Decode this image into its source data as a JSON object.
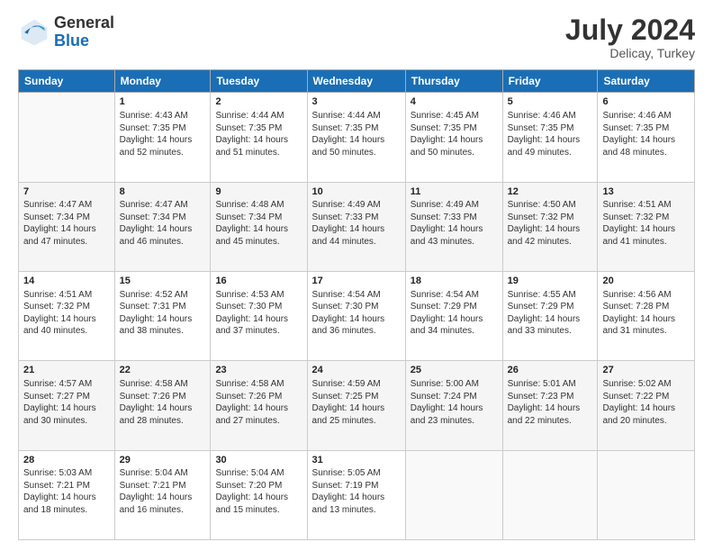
{
  "logo": {
    "general": "General",
    "blue": "Blue"
  },
  "header": {
    "month_year": "July 2024",
    "location": "Delicay, Turkey"
  },
  "weekdays": [
    "Sunday",
    "Monday",
    "Tuesday",
    "Wednesday",
    "Thursday",
    "Friday",
    "Saturday"
  ],
  "weeks": [
    [
      {
        "day": "",
        "sunrise": "",
        "sunset": "",
        "daylight": ""
      },
      {
        "day": "1",
        "sunrise": "Sunrise: 4:43 AM",
        "sunset": "Sunset: 7:35 PM",
        "daylight": "Daylight: 14 hours and 52 minutes."
      },
      {
        "day": "2",
        "sunrise": "Sunrise: 4:44 AM",
        "sunset": "Sunset: 7:35 PM",
        "daylight": "Daylight: 14 hours and 51 minutes."
      },
      {
        "day": "3",
        "sunrise": "Sunrise: 4:44 AM",
        "sunset": "Sunset: 7:35 PM",
        "daylight": "Daylight: 14 hours and 50 minutes."
      },
      {
        "day": "4",
        "sunrise": "Sunrise: 4:45 AM",
        "sunset": "Sunset: 7:35 PM",
        "daylight": "Daylight: 14 hours and 50 minutes."
      },
      {
        "day": "5",
        "sunrise": "Sunrise: 4:46 AM",
        "sunset": "Sunset: 7:35 PM",
        "daylight": "Daylight: 14 hours and 49 minutes."
      },
      {
        "day": "6",
        "sunrise": "Sunrise: 4:46 AM",
        "sunset": "Sunset: 7:35 PM",
        "daylight": "Daylight: 14 hours and 48 minutes."
      }
    ],
    [
      {
        "day": "7",
        "sunrise": "Sunrise: 4:47 AM",
        "sunset": "Sunset: 7:34 PM",
        "daylight": "Daylight: 14 hours and 47 minutes."
      },
      {
        "day": "8",
        "sunrise": "Sunrise: 4:47 AM",
        "sunset": "Sunset: 7:34 PM",
        "daylight": "Daylight: 14 hours and 46 minutes."
      },
      {
        "day": "9",
        "sunrise": "Sunrise: 4:48 AM",
        "sunset": "Sunset: 7:34 PM",
        "daylight": "Daylight: 14 hours and 45 minutes."
      },
      {
        "day": "10",
        "sunrise": "Sunrise: 4:49 AM",
        "sunset": "Sunset: 7:33 PM",
        "daylight": "Daylight: 14 hours and 44 minutes."
      },
      {
        "day": "11",
        "sunrise": "Sunrise: 4:49 AM",
        "sunset": "Sunset: 7:33 PM",
        "daylight": "Daylight: 14 hours and 43 minutes."
      },
      {
        "day": "12",
        "sunrise": "Sunrise: 4:50 AM",
        "sunset": "Sunset: 7:32 PM",
        "daylight": "Daylight: 14 hours and 42 minutes."
      },
      {
        "day": "13",
        "sunrise": "Sunrise: 4:51 AM",
        "sunset": "Sunset: 7:32 PM",
        "daylight": "Daylight: 14 hours and 41 minutes."
      }
    ],
    [
      {
        "day": "14",
        "sunrise": "Sunrise: 4:51 AM",
        "sunset": "Sunset: 7:32 PM",
        "daylight": "Daylight: 14 hours and 40 minutes."
      },
      {
        "day": "15",
        "sunrise": "Sunrise: 4:52 AM",
        "sunset": "Sunset: 7:31 PM",
        "daylight": "Daylight: 14 hours and 38 minutes."
      },
      {
        "day": "16",
        "sunrise": "Sunrise: 4:53 AM",
        "sunset": "Sunset: 7:30 PM",
        "daylight": "Daylight: 14 hours and 37 minutes."
      },
      {
        "day": "17",
        "sunrise": "Sunrise: 4:54 AM",
        "sunset": "Sunset: 7:30 PM",
        "daylight": "Daylight: 14 hours and 36 minutes."
      },
      {
        "day": "18",
        "sunrise": "Sunrise: 4:54 AM",
        "sunset": "Sunset: 7:29 PM",
        "daylight": "Daylight: 14 hours and 34 minutes."
      },
      {
        "day": "19",
        "sunrise": "Sunrise: 4:55 AM",
        "sunset": "Sunset: 7:29 PM",
        "daylight": "Daylight: 14 hours and 33 minutes."
      },
      {
        "day": "20",
        "sunrise": "Sunrise: 4:56 AM",
        "sunset": "Sunset: 7:28 PM",
        "daylight": "Daylight: 14 hours and 31 minutes."
      }
    ],
    [
      {
        "day": "21",
        "sunrise": "Sunrise: 4:57 AM",
        "sunset": "Sunset: 7:27 PM",
        "daylight": "Daylight: 14 hours and 30 minutes."
      },
      {
        "day": "22",
        "sunrise": "Sunrise: 4:58 AM",
        "sunset": "Sunset: 7:26 PM",
        "daylight": "Daylight: 14 hours and 28 minutes."
      },
      {
        "day": "23",
        "sunrise": "Sunrise: 4:58 AM",
        "sunset": "Sunset: 7:26 PM",
        "daylight": "Daylight: 14 hours and 27 minutes."
      },
      {
        "day": "24",
        "sunrise": "Sunrise: 4:59 AM",
        "sunset": "Sunset: 7:25 PM",
        "daylight": "Daylight: 14 hours and 25 minutes."
      },
      {
        "day": "25",
        "sunrise": "Sunrise: 5:00 AM",
        "sunset": "Sunset: 7:24 PM",
        "daylight": "Daylight: 14 hours and 23 minutes."
      },
      {
        "day": "26",
        "sunrise": "Sunrise: 5:01 AM",
        "sunset": "Sunset: 7:23 PM",
        "daylight": "Daylight: 14 hours and 22 minutes."
      },
      {
        "day": "27",
        "sunrise": "Sunrise: 5:02 AM",
        "sunset": "Sunset: 7:22 PM",
        "daylight": "Daylight: 14 hours and 20 minutes."
      }
    ],
    [
      {
        "day": "28",
        "sunrise": "Sunrise: 5:03 AM",
        "sunset": "Sunset: 7:21 PM",
        "daylight": "Daylight: 14 hours and 18 minutes."
      },
      {
        "day": "29",
        "sunrise": "Sunrise: 5:04 AM",
        "sunset": "Sunset: 7:21 PM",
        "daylight": "Daylight: 14 hours and 16 minutes."
      },
      {
        "day": "30",
        "sunrise": "Sunrise: 5:04 AM",
        "sunset": "Sunset: 7:20 PM",
        "daylight": "Daylight: 14 hours and 15 minutes."
      },
      {
        "day": "31",
        "sunrise": "Sunrise: 5:05 AM",
        "sunset": "Sunset: 7:19 PM",
        "daylight": "Daylight: 14 hours and 13 minutes."
      },
      {
        "day": "",
        "sunrise": "",
        "sunset": "",
        "daylight": ""
      },
      {
        "day": "",
        "sunrise": "",
        "sunset": "",
        "daylight": ""
      },
      {
        "day": "",
        "sunrise": "",
        "sunset": "",
        "daylight": ""
      }
    ]
  ]
}
